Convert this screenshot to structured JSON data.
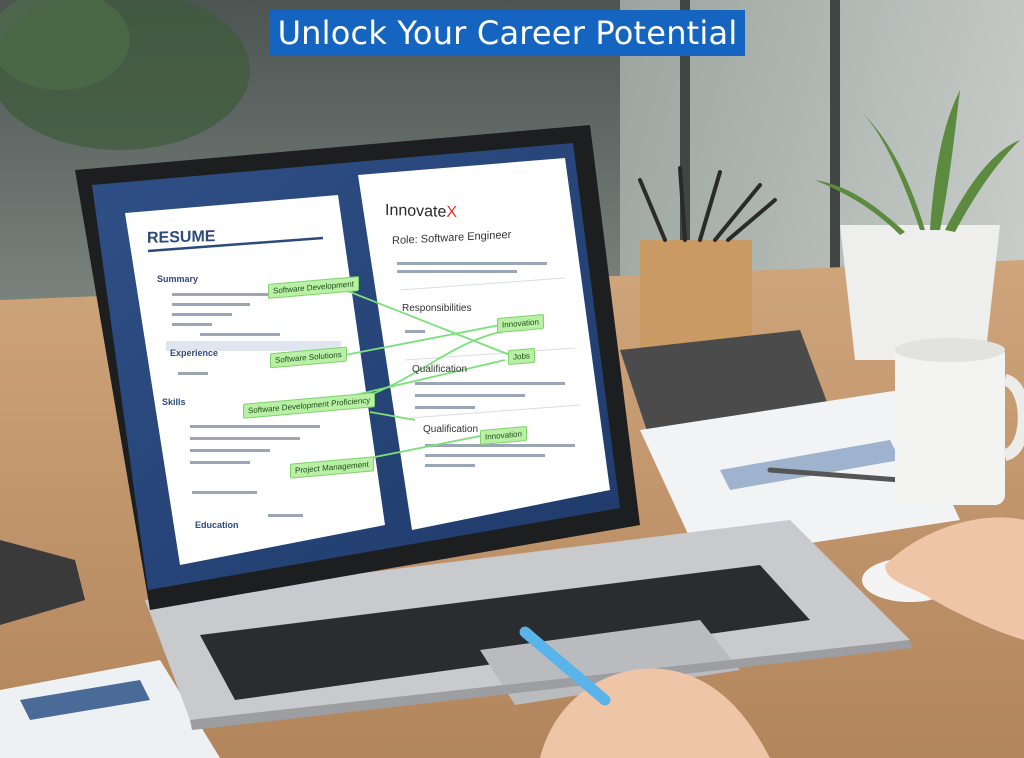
{
  "banner": {
    "title": "Unlock Your Career Potential"
  },
  "resume": {
    "heading": "RESUME",
    "sections": [
      "Summary",
      "Experience",
      "Skills",
      "Education"
    ],
    "skill_tags": [
      "Software Development",
      "Software Solutions",
      "Software Development Proficiency",
      "Project Management"
    ]
  },
  "job_description": {
    "company": "Innovate",
    "company_accent": "X",
    "role": "Role: Software Engineer",
    "sections": [
      "Responsibilities",
      "Qualification",
      "Qualification"
    ],
    "match_tags": [
      "Innovation",
      "Jobs",
      "Innovation"
    ]
  },
  "colors": {
    "banner": "#1565c0",
    "resume_accent": "#2c4a7c",
    "match_highlight": "#b9f0a5",
    "brand_accent": "#d9342b"
  }
}
